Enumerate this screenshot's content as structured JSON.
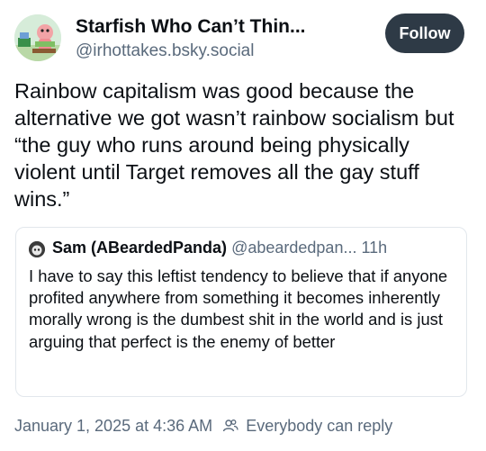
{
  "author": {
    "display_name": "Starfish Who Can’t Thin...",
    "handle": "@irhottakes.bsky.social",
    "avatar_icon": "cartoon-starfish-avatar-icon"
  },
  "follow_button": {
    "label": "Follow"
  },
  "post": {
    "text": "Rainbow capitalism was good because the alternative we got wasn’t rainbow socialism but “the guy who runs around being physically violent until Target removes all the gay stuff wins.”"
  },
  "quoted_post": {
    "author_name": "Sam (ABeardedPanda)",
    "author_handle": "@abeardedpan...",
    "age": "11h",
    "text": "I have to say this leftist tendency to believe that if anyone profited anywhere from something it becomes inherently morally wrong is the dumbest shit in the world and is just arguing that perfect is the enemy of better"
  },
  "footer": {
    "timestamp": "January 1, 2025 at 4:36 AM",
    "reply_setting": "Everybody can reply",
    "reply_icon": "people-icon"
  },
  "colors": {
    "follow_bg": "#2e3a46",
    "muted_text": "#5a6a7c",
    "border": "#e2e7ec"
  }
}
